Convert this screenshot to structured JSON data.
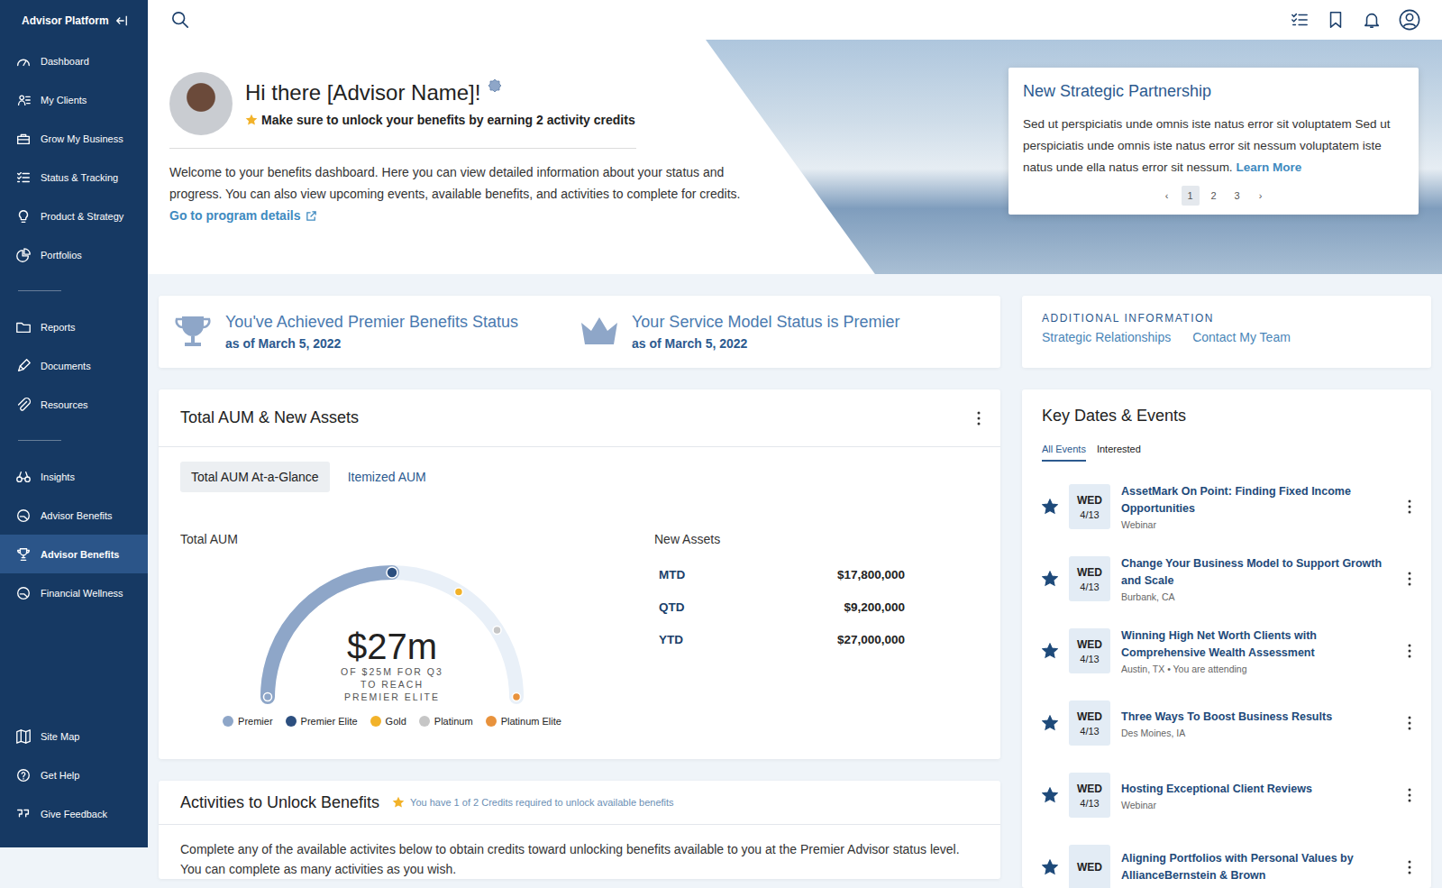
{
  "sidebar": {
    "title": "Advisor Platform",
    "groups": [
      [
        {
          "label": "Dashboard",
          "selected": false
        },
        {
          "label": "My Clients",
          "selected": false
        },
        {
          "label": "Grow My Business",
          "selected": false
        },
        {
          "label": "Status & Tracking",
          "selected": false
        },
        {
          "label": "Product & Strategy",
          "selected": false
        },
        {
          "label": "Portfolios",
          "selected": false
        }
      ],
      [
        {
          "label": "Reports",
          "selected": false
        },
        {
          "label": "Documents",
          "selected": false
        },
        {
          "label": "Resources",
          "selected": false
        }
      ],
      [
        {
          "label": "Insights",
          "selected": false
        },
        {
          "label": "Advisor Benefits",
          "selected": false
        },
        {
          "label": "Advisor Benefits",
          "selected": true
        },
        {
          "label": "Financial Wellness",
          "selected": false
        }
      ]
    ],
    "footer": [
      {
        "label": "Site Map",
        "selected": false
      },
      {
        "label": "Get Help",
        "selected": false
      },
      {
        "label": "Give Feedback",
        "selected": false
      }
    ]
  },
  "hero": {
    "greeting": "Hi there [Advisor Name]!",
    "notice": "Make sure to unlock your benefits by earning 2 activity credits",
    "intro": "Welcome to your benefits dashboard. Here you can view detailed information about your status and progress. You can also view upcoming events, available benefits, and activities to complete for credits.",
    "program_link": "Go to program details"
  },
  "partnership": {
    "title": "New Strategic Partnership",
    "body": "Sed ut perspiciatis unde omnis iste natus error sit voluptatem Sed ut perspiciatis unde omnis iste natus error sit nessum voluptatem iste natus unde ella natus error sit nessum.",
    "link": "Learn More",
    "prev": "‹",
    "next": "›",
    "pages": [
      {
        "label": "1",
        "selected": true
      },
      {
        "label": "2",
        "selected": false
      },
      {
        "label": "3",
        "selected": false
      }
    ]
  },
  "status": [
    {
      "title": "You've Achieved Premier Benefits Status",
      "date": "as of March 5, 2022"
    },
    {
      "title": "Your Service Model Status is Premier",
      "date": "as of March 5, 2022"
    }
  ],
  "additional_info": {
    "heading": "ADDITIONAL INFORMATION",
    "links": [
      "Strategic Relationships",
      "Contact My Team"
    ]
  },
  "aum": {
    "title": "Total AUM & New Assets",
    "tabs": [
      {
        "label": "Total AUM At-a-Glance",
        "selected": true
      },
      {
        "label": "Itemized AUM",
        "selected": false
      }
    ],
    "total_label": "Total AUM",
    "gauge": {
      "level": 0.5,
      "value": "$27m",
      "caption": [
        "OF $25M FOR Q3",
        "TO REACH",
        "PREMIER ELITE"
      ]
    },
    "tiers": [
      {
        "label": "Premier",
        "color": "#8ea6c8",
        "level": 0
      },
      {
        "label": "Premier Elite",
        "color": "#2c4f7f",
        "level": 0.5
      },
      {
        "label": "Gold",
        "color": "#f2b229",
        "level": 0.68
      },
      {
        "label": "Platinum",
        "color": "#c6c6c6",
        "level": 0.82
      },
      {
        "label": "Platinum Elite",
        "color": "#e8923c",
        "level": 1
      }
    ],
    "new_assets": {
      "label": "New Assets",
      "rows": [
        {
          "period": "MTD",
          "amount": "$17,800,000"
        },
        {
          "period": "QTD",
          "amount": "$9,200,000"
        },
        {
          "period": "YTD",
          "amount": "$27,000,000"
        }
      ]
    }
  },
  "events": {
    "title": "Key Dates & Events",
    "tabs": [
      {
        "label": "All Events",
        "selected": true
      },
      {
        "label": "Interested",
        "selected": false
      }
    ],
    "items": [
      {
        "day": "WED",
        "date": "4/13",
        "title": "AssetMark On Point: Finding Fixed Income Opportunities",
        "sub": "Webinar",
        "starred": true
      },
      {
        "day": "WED",
        "date": "4/13",
        "title": "Change Your Business Model to Support Growth and Scale",
        "sub": "Burbank, CA",
        "starred": true
      },
      {
        "day": "WED",
        "date": "4/13",
        "title": "Winning High Net Worth Clients with Comprehensive Wealth Assessment",
        "sub": "Austin, TX • You are attending",
        "starred": true
      },
      {
        "day": "WED",
        "date": "4/13",
        "title": "Three Ways To Boost Business Results",
        "sub": "Des Moines, IA",
        "starred": true
      },
      {
        "day": "WED",
        "date": "4/13",
        "title": "Hosting Exceptional Client Reviews",
        "sub": "Webinar",
        "starred": true
      },
      {
        "day": "WED",
        "title": "Aligning Portfolios with Personal Values by AllianceBernstein & Brown",
        "starred": true
      }
    ]
  },
  "activities": {
    "title": "Activities to Unlock Benefits",
    "credits": "You have 1 of 2 Credits required to unlock available benefits",
    "body": "Complete any of the available activites below to obtain credits toward unlocking benefits available to you at the Premier Advisor status level. You can complete as many activities as you wish."
  }
}
